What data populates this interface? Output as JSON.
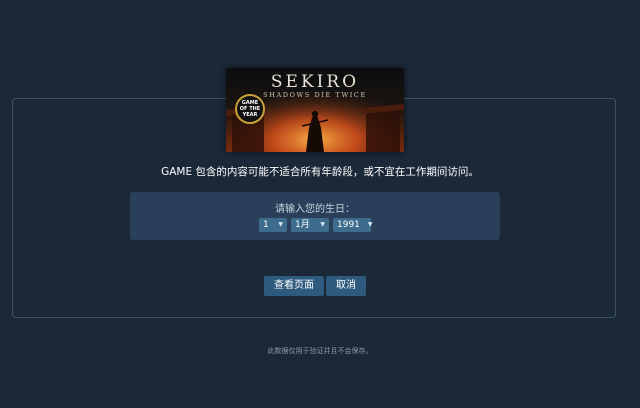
{
  "capsule": {
    "title": "SEKIRO",
    "subtitle": "SHADOWS DIE TWICE",
    "badge": "GAME\nOF THE\nYEAR"
  },
  "warning_text": "GAME 包含的内容可能不适合所有年龄段，或不宜在工作期间访问。",
  "dob": {
    "label": "请输入您的生日：",
    "day": "1",
    "month": "1月",
    "year": "1991",
    "arrow": "▼"
  },
  "buttons": {
    "view_page": "查看页面",
    "cancel": "取消"
  },
  "footnote": "此数据仅用于验证并且不会保存。",
  "colors": {
    "background": "#1b2838",
    "panel": "#2a3f5a",
    "button": "#2e5a7d",
    "select": "#3d6c8d"
  }
}
